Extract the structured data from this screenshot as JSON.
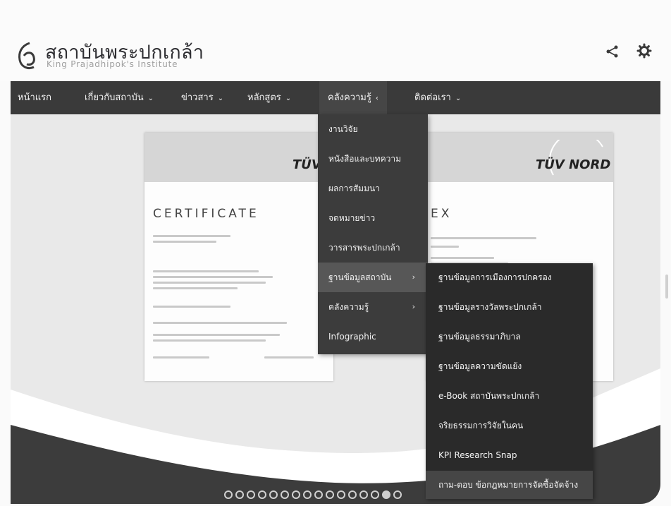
{
  "site": {
    "title": "สถาบันพระปกเกล้า",
    "subtitle": "King Prajadhipok's Institute"
  },
  "header_icons": {
    "share": "share-icon",
    "settings": "gear-icon"
  },
  "nav": {
    "items": [
      {
        "label": "หน้าแรก",
        "caret": ""
      },
      {
        "label": "เกี่ยวกับสถาบัน",
        "caret": "⌄"
      },
      {
        "label": "ข่าวสาร",
        "caret": "⌄"
      },
      {
        "label": "หลักสูตร",
        "caret": "⌄"
      },
      {
        "label": "คลังความรู้",
        "caret": "‹"
      },
      {
        "label": "ติดต่อเรา",
        "caret": "⌄"
      }
    ]
  },
  "dropdown": {
    "items": [
      {
        "label": "งานวิจัย",
        "arrow": ""
      },
      {
        "label": "หนังสือและบทความ",
        "arrow": ""
      },
      {
        "label": "ผลการสัมมนา",
        "arrow": ""
      },
      {
        "label": "จดหมายข่าว",
        "arrow": ""
      },
      {
        "label": "วารสารพระปกเกล้า",
        "arrow": ""
      },
      {
        "label": "ฐานข้อมูลสถาบัน",
        "arrow": "›"
      },
      {
        "label": "คลังความรู้",
        "arrow": "›"
      },
      {
        "label": "Infographic",
        "arrow": ""
      }
    ]
  },
  "submenu": {
    "items": [
      {
        "label": "ฐานข้อมูลการเมืองการปกครอง"
      },
      {
        "label": "ฐานข้อมูลรางวัลพระปกเกล้า"
      },
      {
        "label": "ฐานข้อมูลธรรมาภิบาล"
      },
      {
        "label": "ฐานข้อมูลความขัดแย้ง"
      },
      {
        "label": "e-Book สถาบันพระปกเกล้า"
      },
      {
        "label": "จริยธรรมการวิจัยในคน"
      },
      {
        "label": "KPI Research Snap"
      },
      {
        "label": "ถาม-ตอบ ข้อกฎหมายการจัดซื้อจัดจ้าง"
      }
    ]
  },
  "slider": {
    "certificate_heading": "CERTIFICATE",
    "annex_heading": "EX",
    "brand_left": "TÜV I",
    "brand_right": "TÜV NORD",
    "dot_count": 16,
    "active_dot": 15
  },
  "colors": {
    "navbar": "#3a3a3a",
    "dropdown": "#3c3c3c",
    "submenu": "#2a2a2a",
    "wave": "#3c3c3c"
  }
}
